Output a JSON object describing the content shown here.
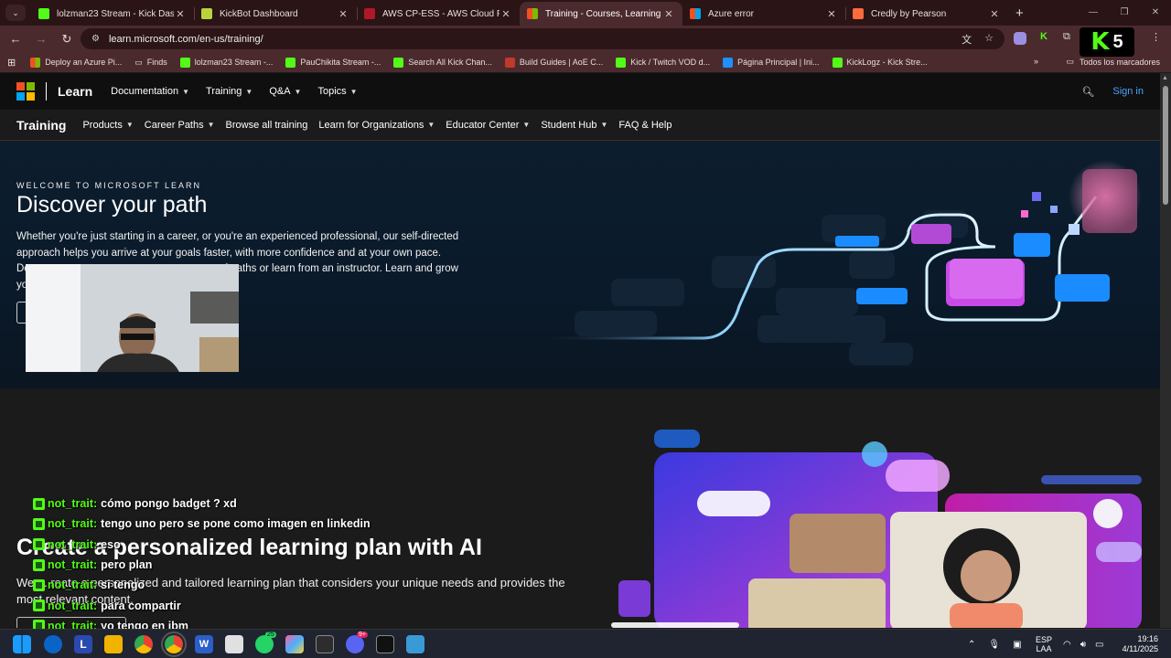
{
  "browser": {
    "tabs": [
      {
        "title": "lolzman23 Stream - Kick Dashb",
        "color": "#53fc18"
      },
      {
        "title": "KickBot Dashboard",
        "color": "#b7d43a"
      },
      {
        "title": "AWS CP-ESS - AWS Cloud Pract",
        "color": "#b0182a"
      },
      {
        "title": "Training - Courses, Learning Pa",
        "color": "#f25022"
      },
      {
        "title": "Azure error",
        "color": "#0078d4"
      },
      {
        "title": "Credly by Pearson",
        "color": "#ff6b3d"
      }
    ],
    "url": "learn.microsoft.com/en-us/training/",
    "kick_badge": {
      "letter": "K",
      "count": "5"
    },
    "bookmarks": [
      {
        "label": "Deploy an Azure Pi...",
        "color": "#f25022"
      },
      {
        "label": "Finds",
        "color": "folder"
      },
      {
        "label": "lolzman23 Stream -...",
        "color": "#53fc18"
      },
      {
        "label": "PauChikita Stream -...",
        "color": "#53fc18"
      },
      {
        "label": "Search All Kick Chan...",
        "color": "#53fc18"
      },
      {
        "label": "Build Guides | AoE C...",
        "color": "#c0392b"
      },
      {
        "label": "Kick / Twitch VOD d...",
        "color": "#53fc18"
      },
      {
        "label": "Página Principal | Ini...",
        "color": "#1e90ff"
      },
      {
        "label": "KickLogz - Kick Stre...",
        "color": "#53fc18"
      }
    ],
    "all_bookmarks": "Todos los marcadores"
  },
  "site": {
    "brand": "Learn",
    "nav": [
      "Documentation",
      "Training",
      "Q&A",
      "Topics"
    ],
    "sign_in": "Sign in",
    "sub_title": "Training",
    "sub_nav": [
      {
        "label": "Products",
        "dropdown": true
      },
      {
        "label": "Career Paths",
        "dropdown": true
      },
      {
        "label": "Browse all training",
        "dropdown": false
      },
      {
        "label": "Learn for Organizations",
        "dropdown": true
      },
      {
        "label": "Educator Center",
        "dropdown": true
      },
      {
        "label": "Student Hub",
        "dropdown": true
      },
      {
        "label": "FAQ & Help",
        "dropdown": false
      }
    ]
  },
  "hero": {
    "eyebrow": "WELCOME TO MICROSOFT LEARN",
    "title": "Discover your path",
    "line1": "Whether you're just starting in a career, or you're an experienced professional, our self-directed",
    "line2": "approach helps you arrive at your goals faster, with more confidence and at your own pace.",
    "line3_start": "De",
    "line3_end": "d paths or learn from an instructor. Learn and grow",
    "line4": "yo"
  },
  "section2": {
    "title": "Create a personalized learning plan with AI",
    "body": "We ... reate a personalized and tailored learning plan that considers your unique needs and provides the most relevant content."
  },
  "chat": [
    {
      "user": "not_trait:",
      "message": "cómo pongo badget ? xd"
    },
    {
      "user": "not_trait:",
      "message": "tengo uno pero se pone como imagen en linkedin"
    },
    {
      "user": "not_trait:",
      "message": "eso"
    },
    {
      "user": "not_trait:",
      "message": "pero plan"
    },
    {
      "user": "not_trait:",
      "message": "si tengo"
    },
    {
      "user": "not_trait:",
      "message": "para compartir"
    },
    {
      "user": "not_trait:",
      "message": "yo tengo en ibm"
    }
  ],
  "taskbar": {
    "lang": "ESP",
    "layout": "LAA",
    "time": "19:16",
    "date": "4/11/2025",
    "whatsapp_badge": "25",
    "discord_badge": "9+"
  }
}
